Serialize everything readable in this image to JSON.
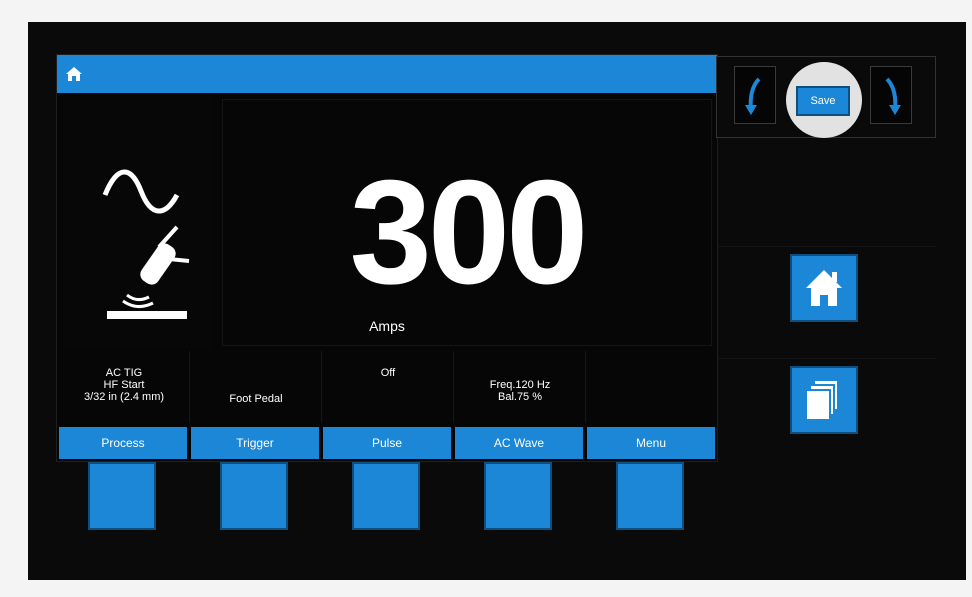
{
  "readout": {
    "value": "300",
    "unit": "Amps"
  },
  "info": [
    {
      "lines": [
        "AC TIG",
        "HF Start",
        "3/32 in (2.4 mm)"
      ]
    },
    {
      "lines": [
        "Foot Pedal"
      ]
    },
    {
      "lines": [
        "Off"
      ]
    },
    {
      "lines": [
        "Freq.120 Hz",
        "Bal.75 %"
      ]
    },
    {
      "lines": []
    }
  ],
  "tabs": [
    "Process",
    "Trigger",
    "Pulse",
    "AC Wave",
    "Menu"
  ],
  "save": {
    "label": "Save"
  },
  "icons": {
    "topbar": "home-icon",
    "process": "tig-torch-ac-wave-icon",
    "side_home": "home-icon",
    "side_pages": "stacked-pages-icon",
    "nav_left": "curved-arrow-left-icon",
    "nav_right": "curved-arrow-right-icon"
  },
  "colors": {
    "accent": "#1b87d6",
    "background": "#0a0a0a",
    "text": "#ffffff"
  }
}
